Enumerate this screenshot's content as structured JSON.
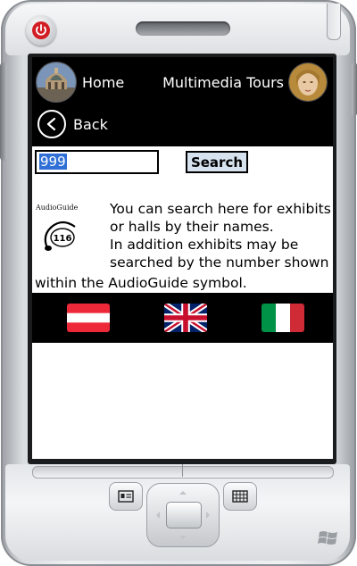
{
  "app": {
    "home_label": "Home",
    "tours_label": "Multimedia Tours",
    "back_label": "Back"
  },
  "search": {
    "value": "999",
    "button_label": "Search"
  },
  "info": {
    "logo_title": "AudioGuide",
    "logo_number": "116",
    "line1": "You can search here for exhibits",
    "line2": "or halls by their names.",
    "line3": "In addition exhibits may be",
    "line4": "searched by the number shown",
    "line5": "within the AudioGuide symbol."
  },
  "languages": [
    {
      "name": "Austrian flag",
      "icon": "austria-flag-icon"
    },
    {
      "name": "British flag",
      "icon": "uk-flag-icon"
    },
    {
      "name": "Italian flag",
      "icon": "italy-flag-icon"
    }
  ],
  "colors": {
    "bar_background": "#000000",
    "search_button_bg": "#d6e2ee",
    "selection": "#2f6fd6"
  }
}
